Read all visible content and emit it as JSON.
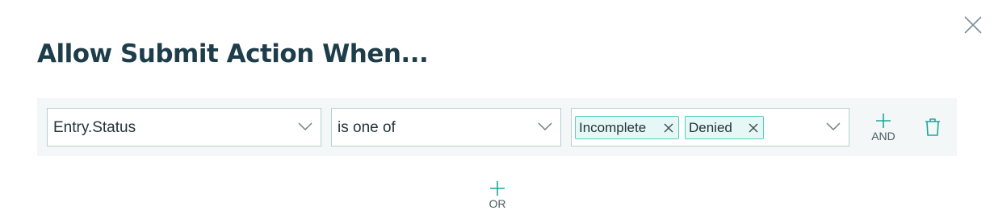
{
  "dialog": {
    "title": "Allow Submit Action When..."
  },
  "condition": {
    "field_value": "Entry.Status",
    "operator_value": "is one of",
    "selected_values": [
      "Incomplete",
      "Denied"
    ],
    "and_label": "AND",
    "or_label": "OR"
  },
  "icons": {
    "close": "close-icon",
    "chevron": "chevron-down-icon",
    "tag_remove": "x-icon",
    "add": "plus-icon",
    "delete": "trash-icon"
  },
  "colors": {
    "accent": "#1aa89a",
    "title": "#1e3d4a",
    "tag_background": "#e5f8f6",
    "tag_border": "#55cbbf",
    "row_background": "#f3f7f8"
  }
}
